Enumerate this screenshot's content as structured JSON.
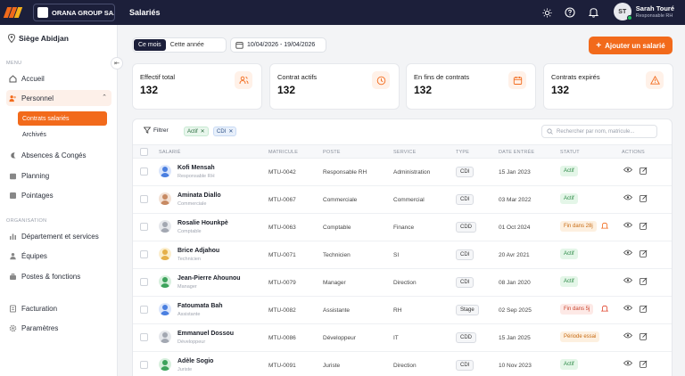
{
  "topbar": {
    "org_name": "ORANA GROUP SA...",
    "page_title": "Salariés",
    "user": {
      "initials": "ST",
      "name": "Sarah Touré",
      "role": "Responsable RH"
    }
  },
  "sidebar": {
    "site": "Siège Abidjan",
    "menu_label": "MENU",
    "org_label": "ORGANISATION",
    "items": {
      "accueil": "Accueil",
      "personnel": "Personnel",
      "contrats": "Contrats salariés",
      "archives": "Archivés",
      "absences": "Absences & Congés",
      "planning": "Planning",
      "pointages": "Pointages",
      "departement": "Département et services",
      "equipes": "Équipes",
      "postes": "Postes & fonctions",
      "facturation": "Facturation",
      "parametres": "Paramètres"
    }
  },
  "toolbar": {
    "period_on": "Ce mois",
    "period_off": "Cette année",
    "date_range": "10/04/2026 - 19/04/2026",
    "add_label": "Ajouter un salarié"
  },
  "stats": [
    {
      "label": "Effectif total",
      "value": "132"
    },
    {
      "label": "Contrat actifs",
      "value": "132"
    },
    {
      "label": "En fins de contrats",
      "value": "132"
    },
    {
      "label": "Contrats expirés",
      "value": "132"
    }
  ],
  "filters": {
    "filter_label": "Filtrer",
    "chip1": "Actif",
    "chip2": "CDI",
    "search_placeholder": "Rechercher par nom, matricule..."
  },
  "columns": {
    "salarie": "SALARIÉ",
    "matricule": "MATRICULE",
    "poste": "POSTE",
    "service": "SERVICE",
    "type": "TYPE",
    "date": "DATE ENTRÉE",
    "statut": "STATUT",
    "actions": "ACTIONS"
  },
  "rows": [
    {
      "name": "Kofi Mensah",
      "role": "Responsable RH",
      "matricule": "MTU-0042",
      "poste": "Responsable RH",
      "service": "Administration",
      "type": "CDI",
      "date": "15 Jan 2023",
      "status": "Actif"
    },
    {
      "name": "Aminata Diallo",
      "role": "Commerciale",
      "matricule": "MTU-0067",
      "poste": "Commerciale",
      "service": "Commercial",
      "type": "CDI",
      "date": "03 Mar 2022",
      "status": "Actif"
    },
    {
      "name": "Rosalie Hounkpè",
      "role": "Comptable",
      "matricule": "MTU-0063",
      "poste": "Comptable",
      "service": "Finance",
      "type": "CDD",
      "date": "01 Oct 2024",
      "status": "Fin dans 28j"
    },
    {
      "name": "Brice Adjahou",
      "role": "Technicien",
      "matricule": "MTU-0071",
      "poste": "Technicien",
      "service": "SI",
      "type": "CDI",
      "date": "20 Avr 2021",
      "status": "Actif"
    },
    {
      "name": "Jean-Pierre Ahounou",
      "role": "Manager",
      "matricule": "MTU-0079",
      "poste": "Manager",
      "service": "Direction",
      "type": "CDI",
      "date": "08 Jan 2020",
      "status": "Actif"
    },
    {
      "name": "Fatoumata Bah",
      "role": "Assistante",
      "matricule": "MTU-0082",
      "poste": "Assistante",
      "service": "RH",
      "type": "Stage",
      "date": "02 Sep 2025",
      "status": "Fin dans 5j"
    },
    {
      "name": "Emmanuel Dossou",
      "role": "Développeur",
      "matricule": "MTU-0086",
      "poste": "Développeur",
      "service": "IT",
      "type": "CDD",
      "date": "15 Jan 2025",
      "status": "Période essai"
    },
    {
      "name": "Adèle Sogio",
      "role": "Juriste",
      "matricule": "MTU-0091",
      "poste": "Juriste",
      "service": "Direction",
      "type": "CDI",
      "date": "10 Nov 2023",
      "status": "Actif"
    }
  ],
  "colors": {
    "accent": "#f26a1b",
    "topbar": "#1c1f3a"
  }
}
